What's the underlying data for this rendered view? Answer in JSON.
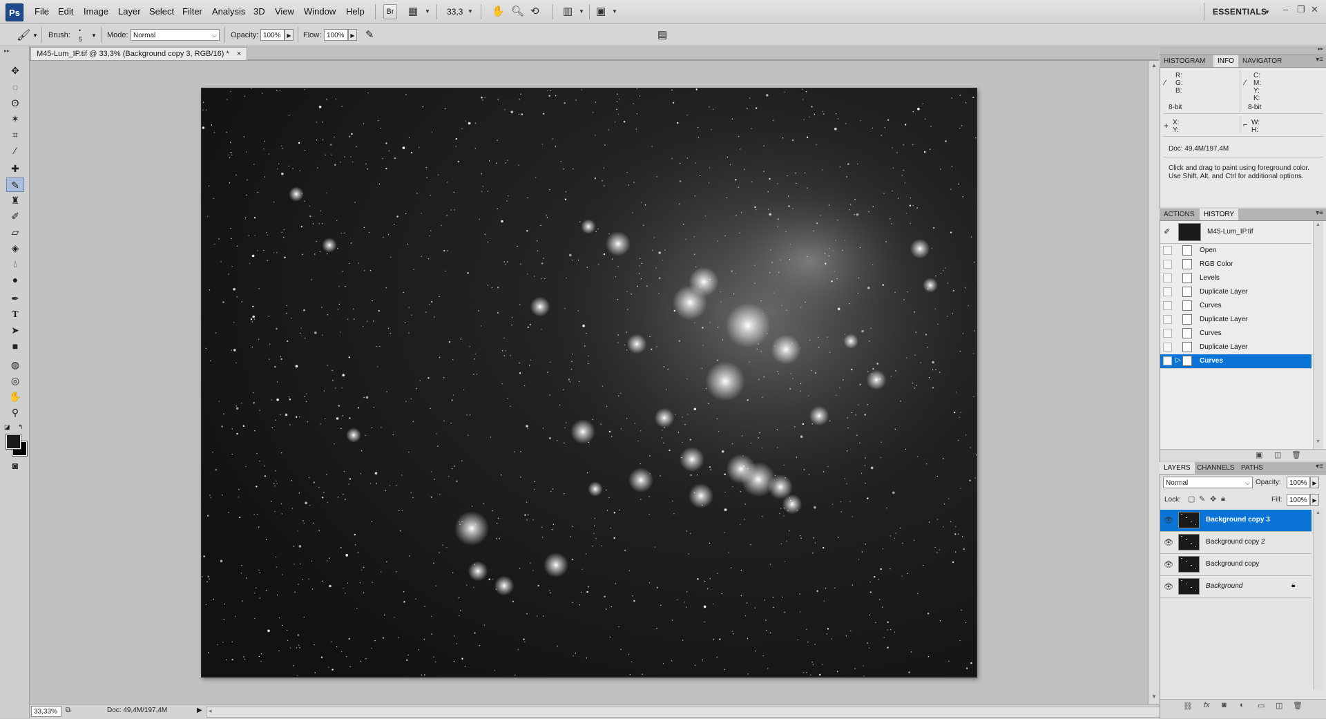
{
  "app": {
    "logo": "Ps",
    "menu": [
      "File",
      "Edit",
      "Image",
      "Layer",
      "Select",
      "Filter",
      "Analysis",
      "3D",
      "View",
      "Window",
      "Help"
    ],
    "bridge_label": "Br",
    "zoom_value": "33,3",
    "workspace": "ESSENTIALS",
    "icons": [
      "hand-icon",
      "zoom-icon",
      "rotate-view-icon",
      "arrange-documents-icon",
      "screen-mode-icon"
    ]
  },
  "options": {
    "brush_label": "Brush:",
    "brush_size": "5",
    "mode_label": "Mode:",
    "mode_value": "Normal",
    "opacity_label": "Opacity:",
    "opacity_value": "100%",
    "flow_label": "Flow:",
    "flow_value": "100%"
  },
  "document": {
    "tab_title": "M45-Lum_IP.tif @ 33,3% (Background copy 3, RGB/16) *",
    "close_glyph": "×"
  },
  "status": {
    "zoom": "33,33%",
    "doc_info": "Doc: 49,4M/197,4M"
  },
  "info_panel": {
    "tabs": [
      "HISTOGRAM",
      "INFO",
      "NAVIGATOR"
    ],
    "rgb_labels": [
      "R:",
      "G:",
      "B:"
    ],
    "cmyk_labels": [
      "C:",
      "M:",
      "Y:",
      "K:"
    ],
    "bit_left": "8-bit",
    "bit_right": "8-bit",
    "xy_labels": [
      "X:",
      "Y:"
    ],
    "wh_labels": [
      "W:",
      "H:"
    ],
    "doc_info": "Doc: 49,4M/197,4M",
    "hint": "Click and drag to paint using foreground color.  Use Shift, Alt, and Ctrl for additional options."
  },
  "history_panel": {
    "tabs": [
      "ACTIONS",
      "HISTORY"
    ],
    "snapshot": "M45-Lum_IP.tif",
    "items": [
      "Open",
      "RGB Color",
      "Levels",
      "Duplicate Layer",
      "Curves",
      "Duplicate Layer",
      "Curves",
      "Duplicate Layer",
      "Curves"
    ],
    "active_index": 8
  },
  "layers_panel": {
    "tabs": [
      "LAYERS",
      "CHANNELS",
      "PATHS"
    ],
    "blend_mode": "Normal",
    "opacity_label": "Opacity:",
    "opacity_value": "100%",
    "lock_label": "Lock:",
    "fill_label": "Fill:",
    "fill_value": "100%",
    "layers": [
      "Background copy 3",
      "Background copy 2",
      "Background copy",
      "Background"
    ],
    "active_index": 0
  },
  "colors": {
    "selection": "#0a74d6",
    "ps_blue": "#1d4b8c"
  }
}
